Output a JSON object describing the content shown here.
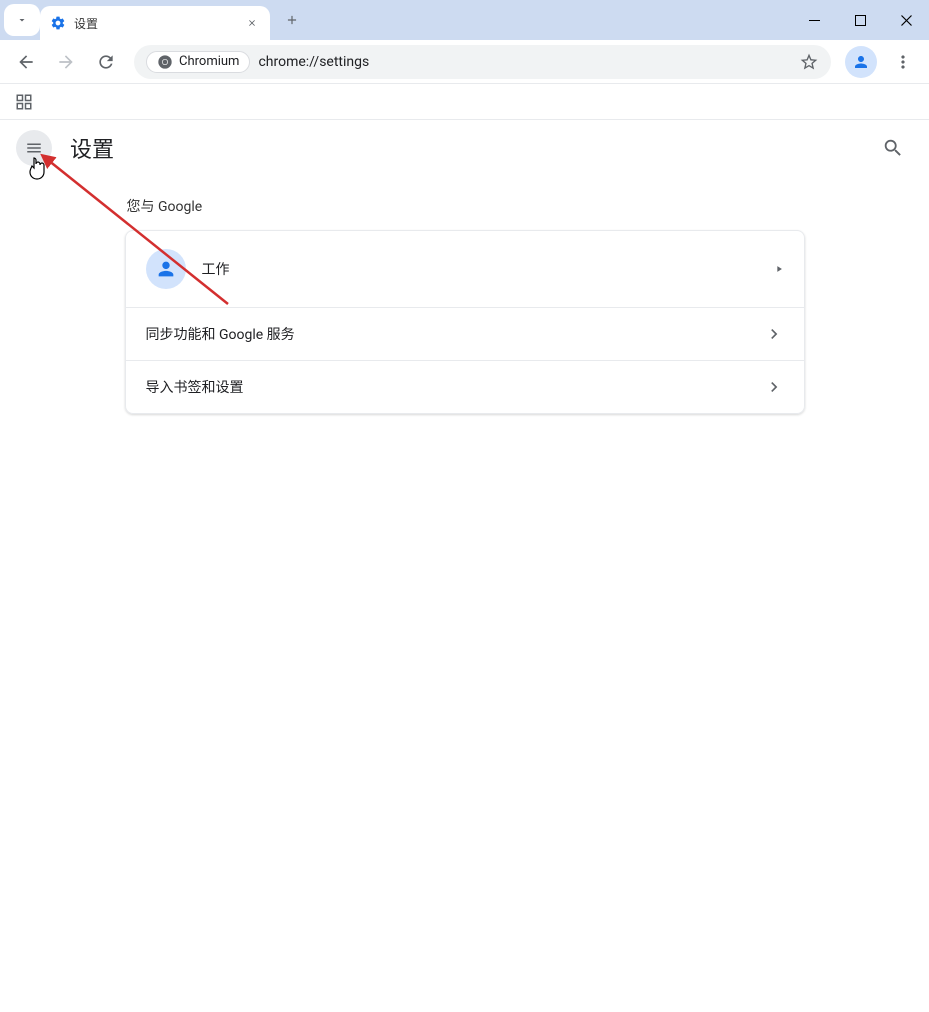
{
  "tab": {
    "title": "设置"
  },
  "omnibox": {
    "chip_label": "Chromium",
    "url": "chrome://settings"
  },
  "settings": {
    "title": "设置",
    "section_title": "您与 Google",
    "rows": {
      "profile": "工作",
      "sync": "同步功能和 Google 服务",
      "import": "导入书签和设置"
    }
  }
}
